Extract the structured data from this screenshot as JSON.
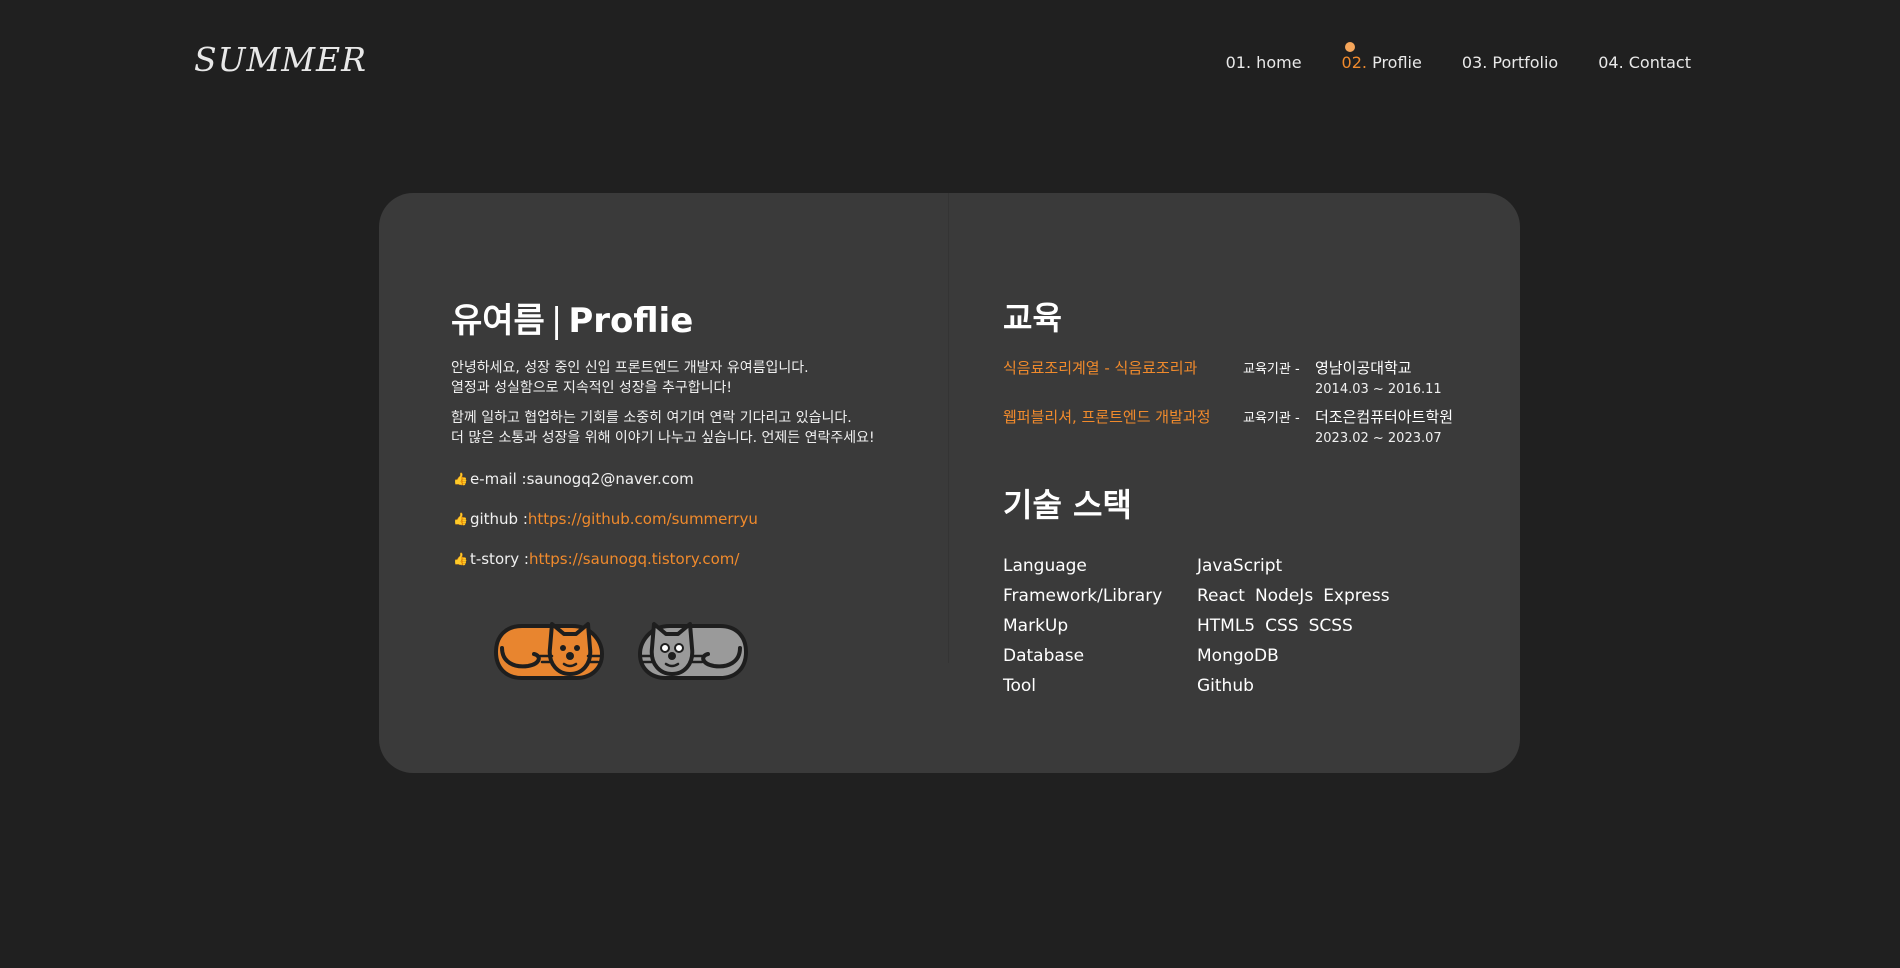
{
  "header": {
    "logo": "SUMMER",
    "nav": [
      {
        "num": "01.",
        "label": "home",
        "active": false
      },
      {
        "num": "02.",
        "label": "Proflie",
        "active": true
      },
      {
        "num": "03.",
        "label": "Portfolio",
        "active": false
      },
      {
        "num": "04.",
        "label": "Contact",
        "active": false
      }
    ]
  },
  "profile": {
    "name": "유여름",
    "separator": "|",
    "title": "Proflie",
    "intro_1": [
      "안녕하세요, 성장 중인 신입 프론트엔드 개발자 유여름입니다.",
      "열정과 성실함으로 지속적인 성장을 추구합니다!"
    ],
    "intro_2": [
      "함께 일하고 협업하는 기회를 소중히 여기며 연락 기다리고 있습니다.",
      "더 많은 소통과 성장을 위해 이야기 나누고 싶습니다. 언제든 연락주세요!"
    ],
    "contacts": [
      {
        "label": "e-mail : ",
        "value": "saunogq2@naver.com",
        "is_link": false
      },
      {
        "label": "github : ",
        "value": "https://github.com/summerryu",
        "is_link": true
      },
      {
        "label": "t-story : ",
        "value": "https://saunogq.tistory.com/",
        "is_link": true
      }
    ],
    "cat_colors": {
      "orange": "#e8852f",
      "gray": "#9a9a9a",
      "outline": "#1e1e1e"
    }
  },
  "education": {
    "title": "교육",
    "items": [
      {
        "course": "식음료조리계열 - 식음료조리과",
        "label": "교육기관 -",
        "school": "영남이공대학교",
        "period": "2014.03 ~ 2016.11"
      },
      {
        "course": "웹퍼블리셔, 프론트엔드 개발과정",
        "label": "교육기관 -",
        "school": "더조은컴퓨터아트학원",
        "period": "2023.02 ~ 2023.07"
      }
    ]
  },
  "stack": {
    "title": "기술 스택",
    "rows": [
      {
        "category": "Language",
        "items": [
          "JavaScript"
        ]
      },
      {
        "category": "Framework/Library",
        "items": [
          "React",
          "NodeJs",
          "Express"
        ]
      },
      {
        "category": "MarkUp",
        "items": [
          "HTML5",
          "CSS",
          "SCSS"
        ]
      },
      {
        "category": "Database",
        "items": [
          "MongoDB"
        ]
      },
      {
        "category": "Tool",
        "items": [
          "Github"
        ]
      }
    ]
  },
  "colors": {
    "background": "#202020",
    "card": "#3a3a3a",
    "accent": "#f08a2c"
  }
}
